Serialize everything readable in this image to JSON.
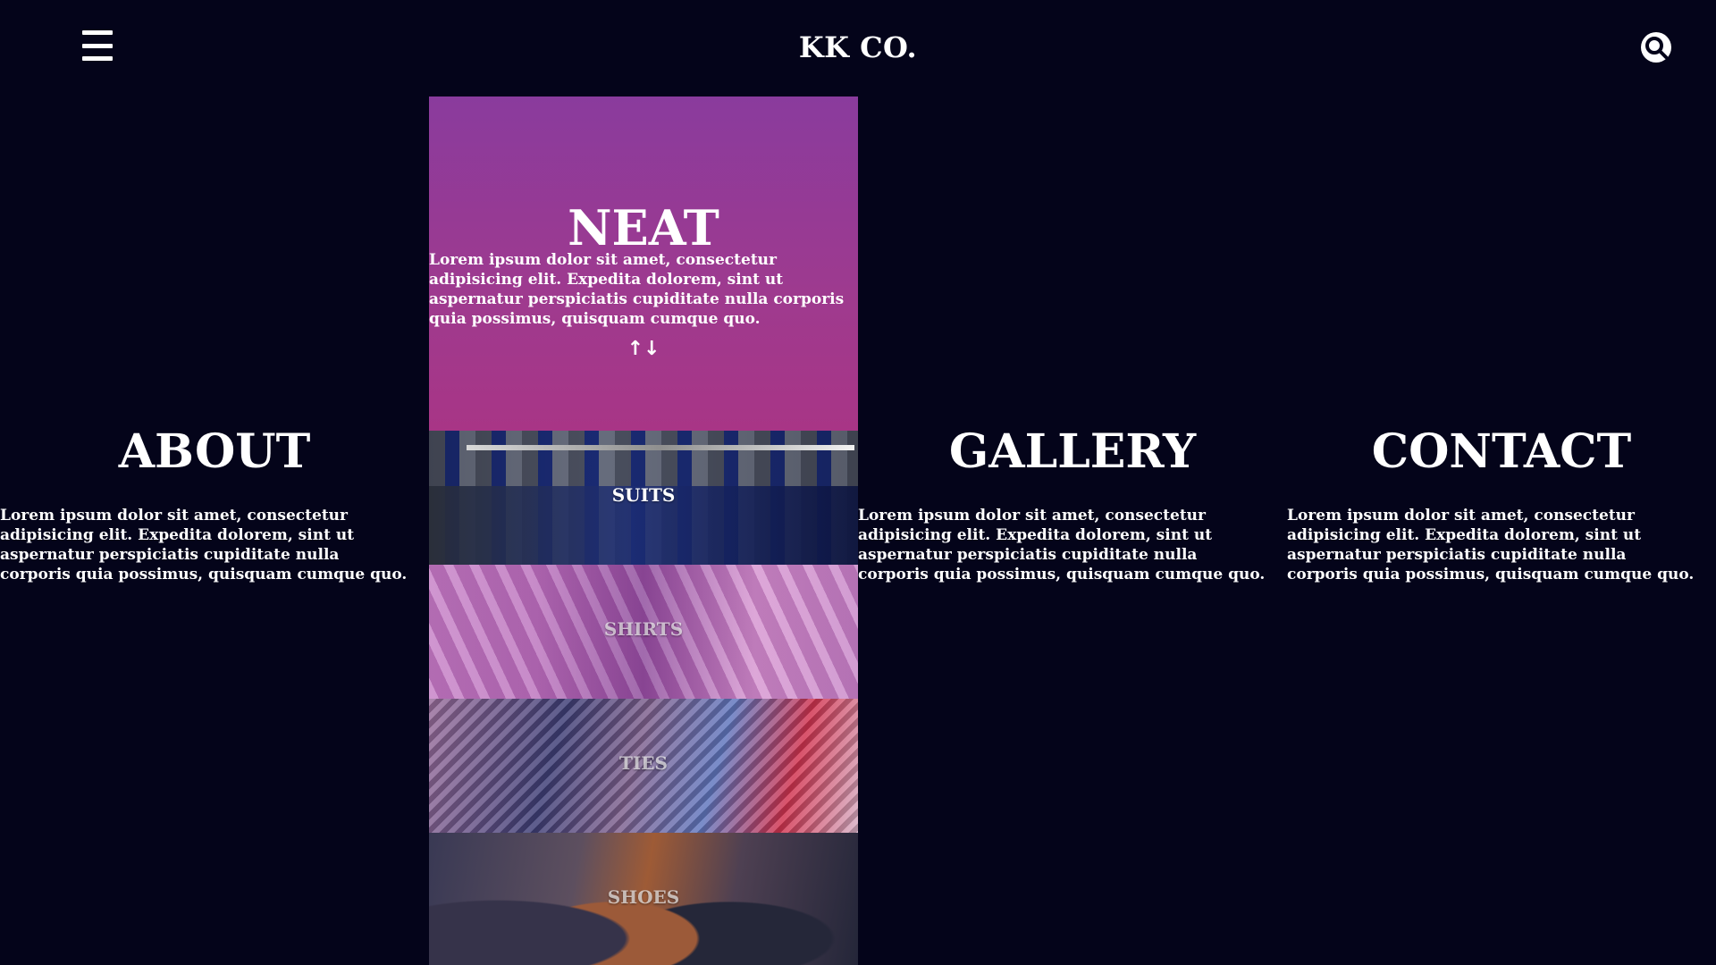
{
  "header": {
    "menu_icon": "hamburger-menu-icon",
    "brand": "KK CO.",
    "search_icon": "search-icon"
  },
  "hero": {
    "title": "NEAT",
    "text": "Lorem ipsum dolor sit amet, consectetur adipisicing elit. Expedita dolorem, sint ut aspernatur perspiciatis cupiditate nulla corporis quia possimus, quisquam cumque quo.",
    "controls": "↑↓"
  },
  "sections": {
    "about": {
      "title": "ABOUT",
      "text": "Lorem ipsum dolor sit amet, consectetur adipisicing elit. Expedita dolorem, sint ut aspernatur perspiciatis cupiditate nulla corporis quia possimus, quisquam cumque quo."
    },
    "gallery": {
      "title": "GALLERY",
      "text": "Lorem ipsum dolor sit amet, consectetur adipisicing elit. Expedita dolorem, sint ut aspernatur perspiciatis cupiditate nulla corporis quia possimus, quisquam cumque quo."
    },
    "contact": {
      "title": "CONTACT",
      "text": "Lorem ipsum dolor sit amet, consectetur adipisicing elit. Expedita dolorem, sint ut aspernatur perspiciatis cupiditate nulla corporis quia possimus, quisquam cumque quo."
    }
  },
  "categories": [
    {
      "label": "SUITS"
    },
    {
      "label": "SHIRTS"
    },
    {
      "label": "TIES"
    },
    {
      "label": "SHOES"
    }
  ],
  "colors": {
    "background": "#04041a",
    "accent": "#9f3a8e",
    "text": "#ffffff"
  }
}
